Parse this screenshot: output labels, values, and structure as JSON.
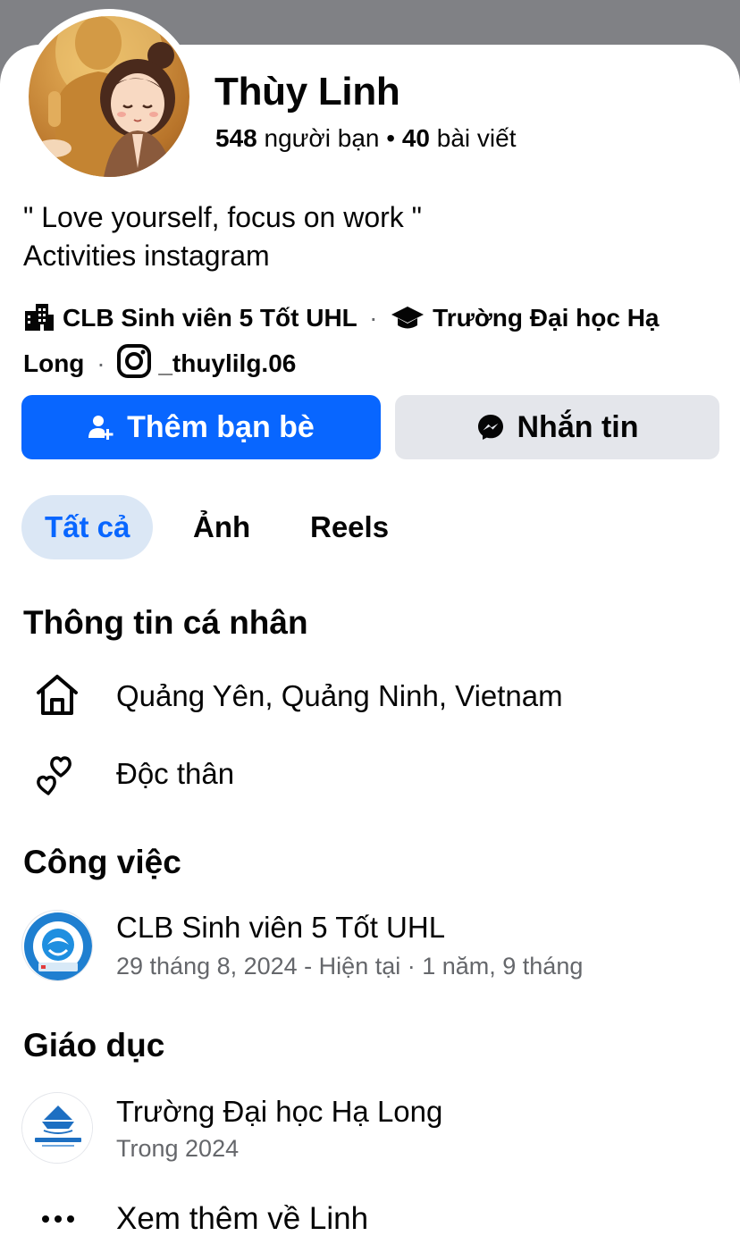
{
  "profile": {
    "name": "Thùy Linh",
    "friends_count": "548",
    "friends_label": "người bạn",
    "dot": "•",
    "posts_count": "40",
    "posts_label": "bài viết",
    "bio_line1": "\" Love yourself, focus on work \"",
    "bio_line2": "Activities instagram"
  },
  "links": {
    "work": "CLB Sinh viên 5 Tốt UHL",
    "school_part1": "Trường Đại học Hạ",
    "school_part2": "Long",
    "instagram": "_thuylilg.06",
    "separator": "·"
  },
  "actions": {
    "add_friend": "Thêm bạn bè",
    "message": "Nhắn tin"
  },
  "tabs": [
    {
      "label": "Tất cả",
      "active": true
    },
    {
      "label": "Ảnh",
      "active": false
    },
    {
      "label": "Reels",
      "active": false
    }
  ],
  "personal_info": {
    "title": "Thông tin cá nhân",
    "hometown": "Quảng Yên, Quảng Ninh, Vietnam",
    "relationship": "Độc thân"
  },
  "work": {
    "title": "Công việc",
    "org": "CLB Sinh viên 5 Tốt UHL",
    "period": "29 tháng 8, 2024 - Hiện tại · 1 năm, 9 tháng"
  },
  "education": {
    "title": "Giáo dục",
    "school": "Trường Đại học Hạ Long",
    "period": "Trong 2024"
  },
  "see_more": "Xem thêm về Linh",
  "colors": {
    "accent": "#0866ff",
    "tab_active_bg": "#dbe7f5",
    "secondary_button_bg": "#e4e6eb",
    "muted_text": "#65676b"
  }
}
